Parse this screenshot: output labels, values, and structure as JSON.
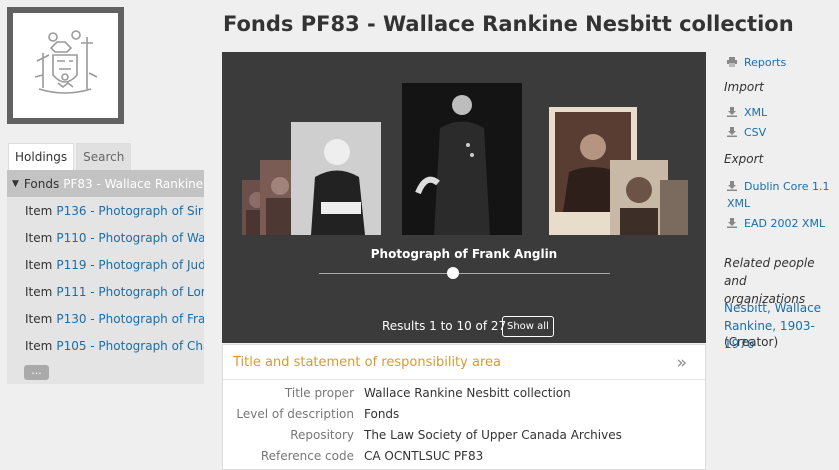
{
  "title": "Fonds PF83 - Wallace Rankine Nesbitt collection",
  "tabs": {
    "holdings": "Holdings",
    "search": "Search"
  },
  "tree": {
    "root_level": "Fonds",
    "root_title": "PF83 - Wallace Rankine ...",
    "items": [
      {
        "level": "Item",
        "title": "P136 - Photograph of Sir ..."
      },
      {
        "level": "Item",
        "title": "P110 - Photograph of Wal..."
      },
      {
        "level": "Item",
        "title": "P119 - Photograph of Jud..."
      },
      {
        "level": "Item",
        "title": "P111 - Photograph of Lor..."
      },
      {
        "level": "Item",
        "title": "P130 - Photograph of Fra..."
      },
      {
        "level": "Item",
        "title": "P105 - Photograph of Cha..."
      }
    ],
    "more": "..."
  },
  "carousel": {
    "caption": "Photograph of Frank Anglin",
    "results": "Results 1 to 10 of 27",
    "show_all": "Show all",
    "slider_position": 0.46
  },
  "area": {
    "heading": "Title and statement of responsibility area",
    "chevron": "»",
    "fields": [
      {
        "label": "Title proper",
        "value": "Wallace Rankine Nesbitt collection"
      },
      {
        "label": "Level of description",
        "value": "Fonds"
      },
      {
        "label": "Repository",
        "value": "The Law Society of Upper Canada Archives",
        "link": true
      },
      {
        "label": "Reference code",
        "value": "CA OCNTLSUC PF83"
      }
    ]
  },
  "sidebar_right": {
    "reports": "Reports",
    "import_heading": "Import",
    "import_xml": "XML",
    "import_csv": "CSV",
    "export_heading": "Export",
    "export_dc_line1": "Dublin Core 1.1",
    "export_dc_line2": "XML",
    "export_ead": "EAD 2002 XML",
    "related_heading_line1": "Related people and",
    "related_heading_line2": "organizations",
    "related_name_line1": "Nesbitt, Wallace",
    "related_name_line2": "Rankine, 1903-1976",
    "related_role": "(Creator)"
  },
  "colors": {
    "link": "#1a6ea8",
    "area_heading": "#d39b34",
    "carousel_bg": "#3b3b3b"
  },
  "icons": {
    "reports": "printer-icon",
    "import": "download-icon",
    "export": "download-icon"
  }
}
